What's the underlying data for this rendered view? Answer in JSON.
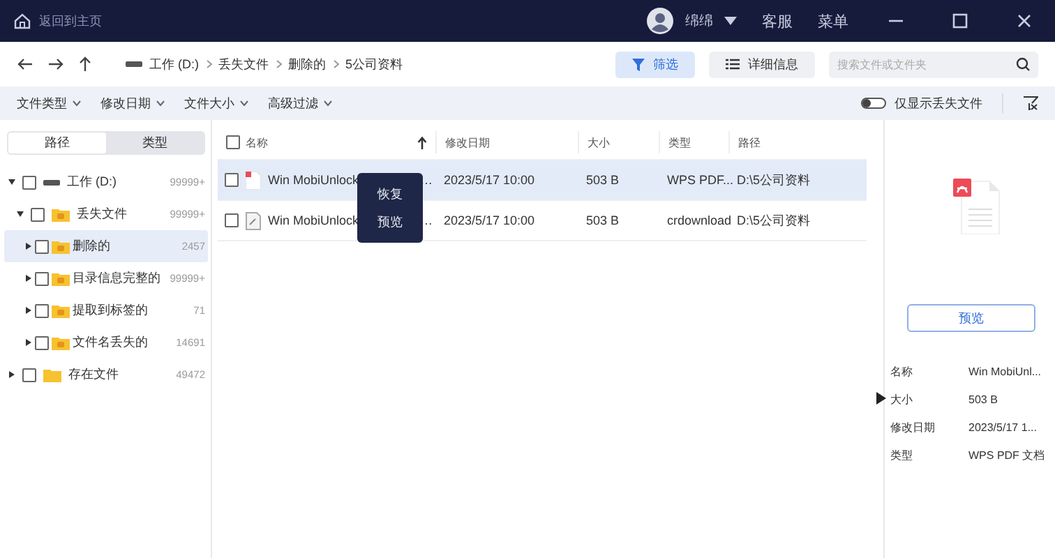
{
  "titlebar": {
    "home_label": "返回到主页",
    "user": "绵绵",
    "links": [
      "客服",
      "菜单"
    ]
  },
  "toolbar": {
    "breadcrumb": [
      "工作 (D:)",
      "丢失文件",
      "删除的",
      "5公司资料"
    ],
    "filter_button": {
      "label": "筛选",
      "selected": true
    },
    "details_button": {
      "label": "详细信息",
      "selected": false
    },
    "search": {
      "placeholder": "搜索文件或文件夹"
    }
  },
  "filters": {
    "dropdowns": [
      "文件类型",
      "修改日期",
      "文件大小",
      "高级过滤"
    ],
    "lost_only": {
      "label": "仅显示丢失文件",
      "on": false
    }
  },
  "sidebar": {
    "tabs": [
      {
        "label": "路径",
        "selected": true
      },
      {
        "label": "类型",
        "selected": false
      }
    ],
    "tree": [
      {
        "kind": "drive",
        "label": "工作 (D:)",
        "count": "99999+",
        "expanded": true,
        "checked": false,
        "selected": false,
        "children": [
          {
            "kind": "folder",
            "label": "丢失文件",
            "count": "99999+",
            "expanded": true,
            "checked": false,
            "selected": false,
            "children": [
              {
                "kind": "folder",
                "label": "删除的",
                "count": "2457",
                "expanded": false,
                "checked": false,
                "selected": true
              },
              {
                "kind": "folder",
                "label": "目录信息完整的",
                "count": "99999+",
                "expanded": false,
                "checked": false,
                "selected": false
              },
              {
                "kind": "folder",
                "label": "提取到标签的",
                "count": "71",
                "expanded": false,
                "checked": false,
                "selected": false
              },
              {
                "kind": "folder",
                "label": "文件名丢失的",
                "count": "14691",
                "expanded": false,
                "checked": false,
                "selected": false
              }
            ]
          }
        ]
      },
      {
        "kind": "folder",
        "label": "存在文件",
        "count": "49472",
        "expanded": false,
        "checked": false,
        "selected": false
      }
    ]
  },
  "table": {
    "all_checked": false,
    "columns": [
      {
        "label": "名称",
        "sorted": true
      },
      {
        "label": "修改日期",
        "sorted": false
      },
      {
        "label": "大小",
        "sorted": false
      },
      {
        "label": "类型",
        "sorted": false
      },
      {
        "label": "路径",
        "sorted": false
      }
    ],
    "rows": [
      {
        "kind": "pdf",
        "checked": false,
        "selected": true,
        "name": "Win MobiUnlock",
        "name_end": "…",
        "date": "2023/5/17 10:00",
        "size": "503 B",
        "type": "WPS PDF...",
        "path": "D:\\5公司资料"
      },
      {
        "kind": "generic",
        "checked": false,
        "selected": false,
        "name": "Win MobiUnlock",
        "name_end": "…",
        "date": "2023/5/17 10:00",
        "size": "503 B",
        "type": "crdownload",
        "path": "D:\\5公司资料"
      }
    ]
  },
  "context_menu": [
    "恢复",
    "预览"
  ],
  "details": {
    "preview_button": "预览",
    "fields": [
      {
        "label": "名称",
        "value": "Win MobiUnl..."
      },
      {
        "label": "大小",
        "value": "503 B"
      },
      {
        "label": "修改日期",
        "value": "2023/5/17 1..."
      },
      {
        "label": "类型",
        "value": "WPS PDF 文档"
      }
    ]
  }
}
